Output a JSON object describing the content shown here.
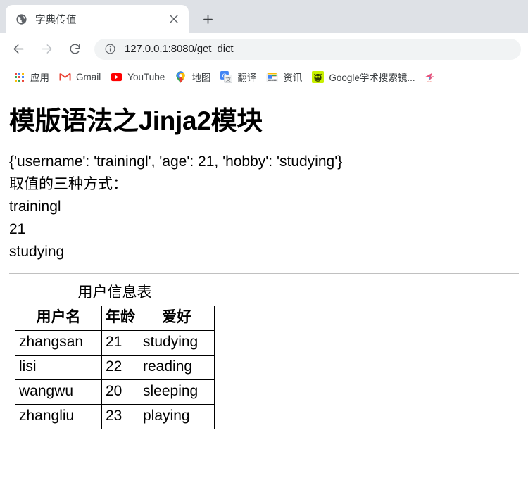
{
  "browser": {
    "tab": {
      "title": "字典传值",
      "favicon": "globe-icon",
      "close_label": "×"
    },
    "new_tab_label": "+",
    "toolbar": {
      "back": "back-arrow-icon",
      "forward": "forward-arrow-icon",
      "reload": "reload-icon",
      "site_info": "info-circle-icon",
      "url": "127.0.0.1:8080/get_dict"
    },
    "bookmarks": [
      {
        "label": "应用",
        "icon": "apps-grid-icon"
      },
      {
        "label": "Gmail",
        "icon": "gmail-icon"
      },
      {
        "label": "YouTube",
        "icon": "youtube-icon"
      },
      {
        "label": "地图",
        "icon": "google-maps-pin-icon"
      },
      {
        "label": "翻译",
        "icon": "google-translate-icon"
      },
      {
        "label": "资讯",
        "icon": "google-news-icon"
      },
      {
        "label": "Google学术搜索镜...",
        "icon": "green-monster-icon"
      },
      {
        "label": "",
        "icon": "bird-logo-icon"
      }
    ]
  },
  "page": {
    "heading": "模版语法之Jinja2模块",
    "dict_repr": "{'username': 'trainingl', 'age': 21, 'hobby': 'studying'}",
    "access_label": "取值的三种方式：",
    "values": [
      "trainingl",
      "21",
      "studying"
    ],
    "table": {
      "caption": "用户信息表",
      "headers": [
        "用户名",
        "年龄",
        "爱好"
      ],
      "rows": [
        {
          "name": "zhangsan",
          "age": "21",
          "hobby": "studying"
        },
        {
          "name": "lisi",
          "age": "22",
          "hobby": "reading"
        },
        {
          "name": "wangwu",
          "age": "20",
          "hobby": "sleeping"
        },
        {
          "name": "zhangliu",
          "age": "23",
          "hobby": "playing"
        }
      ]
    }
  },
  "colors": {
    "tabstrip": "#dee1e6",
    "omnibox": "#f1f3f4",
    "text": "#202124"
  }
}
